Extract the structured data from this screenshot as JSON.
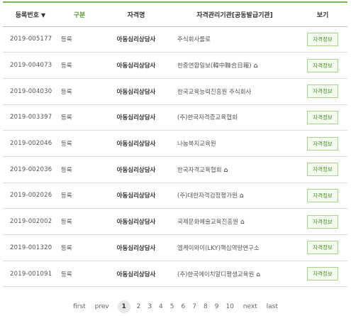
{
  "header": {
    "reg_no": "등록번호",
    "sort_arrow": "▼",
    "status": "구분",
    "name": "자격명",
    "org": "자격관리기관[공동발급기관]",
    "view": "보기"
  },
  "rows": [
    {
      "reg_no": "2019-005177",
      "status": "등록",
      "name": "아동심리상담사",
      "org": "주식회사룰로",
      "home": false,
      "view": "자격정보"
    },
    {
      "reg_no": "2019-004073",
      "status": "등록",
      "name": "아동심리상담사",
      "org": "한중연합일보(韓中聯合日報)",
      "home": true,
      "view": "자격정보"
    },
    {
      "reg_no": "2019-004030",
      "status": "등록",
      "name": "아동심리상담사",
      "org": "한국교육능력진흥원 주식회사",
      "home": false,
      "view": "자격정보"
    },
    {
      "reg_no": "2019-003397",
      "status": "등록",
      "name": "아동심리상담사",
      "org": "(주)한국자격증교육협회",
      "home": false,
      "view": "자격정보"
    },
    {
      "reg_no": "2019-002046",
      "status": "등록",
      "name": "아동심리상담사",
      "org": "나눔복지교육원",
      "home": false,
      "view": "자격정보"
    },
    {
      "reg_no": "2019-002036",
      "status": "등록",
      "name": "아동심리상담사",
      "org": "한국자격교육협회",
      "home": true,
      "view": "자격정보"
    },
    {
      "reg_no": "2019-002026",
      "status": "등록",
      "name": "아동심리상담사",
      "org": "(주)대한자격검정평가원",
      "home": true,
      "view": "자격정보"
    },
    {
      "reg_no": "2019-002002",
      "status": "등록",
      "name": "아동심리상담사",
      "org": "국제문화예술교육진흥원",
      "home": true,
      "view": "자격정보"
    },
    {
      "reg_no": "2019-001320",
      "status": "등록",
      "name": "아동심리상담사",
      "org": "엘케이와이(LKY)핵심역량연구소",
      "home": false,
      "view": "자격정보"
    },
    {
      "reg_no": "2019-001091",
      "status": "등록",
      "name": "아동심리상담사",
      "org": "(주)한국에이치알디평생교육원",
      "home": true,
      "view": "자격정보"
    }
  ],
  "pagination": {
    "first": "first",
    "prev": "prev",
    "pages": [
      "1",
      "2",
      "3",
      "4",
      "5",
      "6",
      "7",
      "8",
      "9",
      "10"
    ],
    "current": "1",
    "next": "next",
    "last": "last"
  },
  "icons": {
    "home": "home-icon"
  },
  "colors": {
    "accent": "#7ab55c",
    "button_text": "#4e8f2c",
    "button_border": "#a9d48e"
  }
}
